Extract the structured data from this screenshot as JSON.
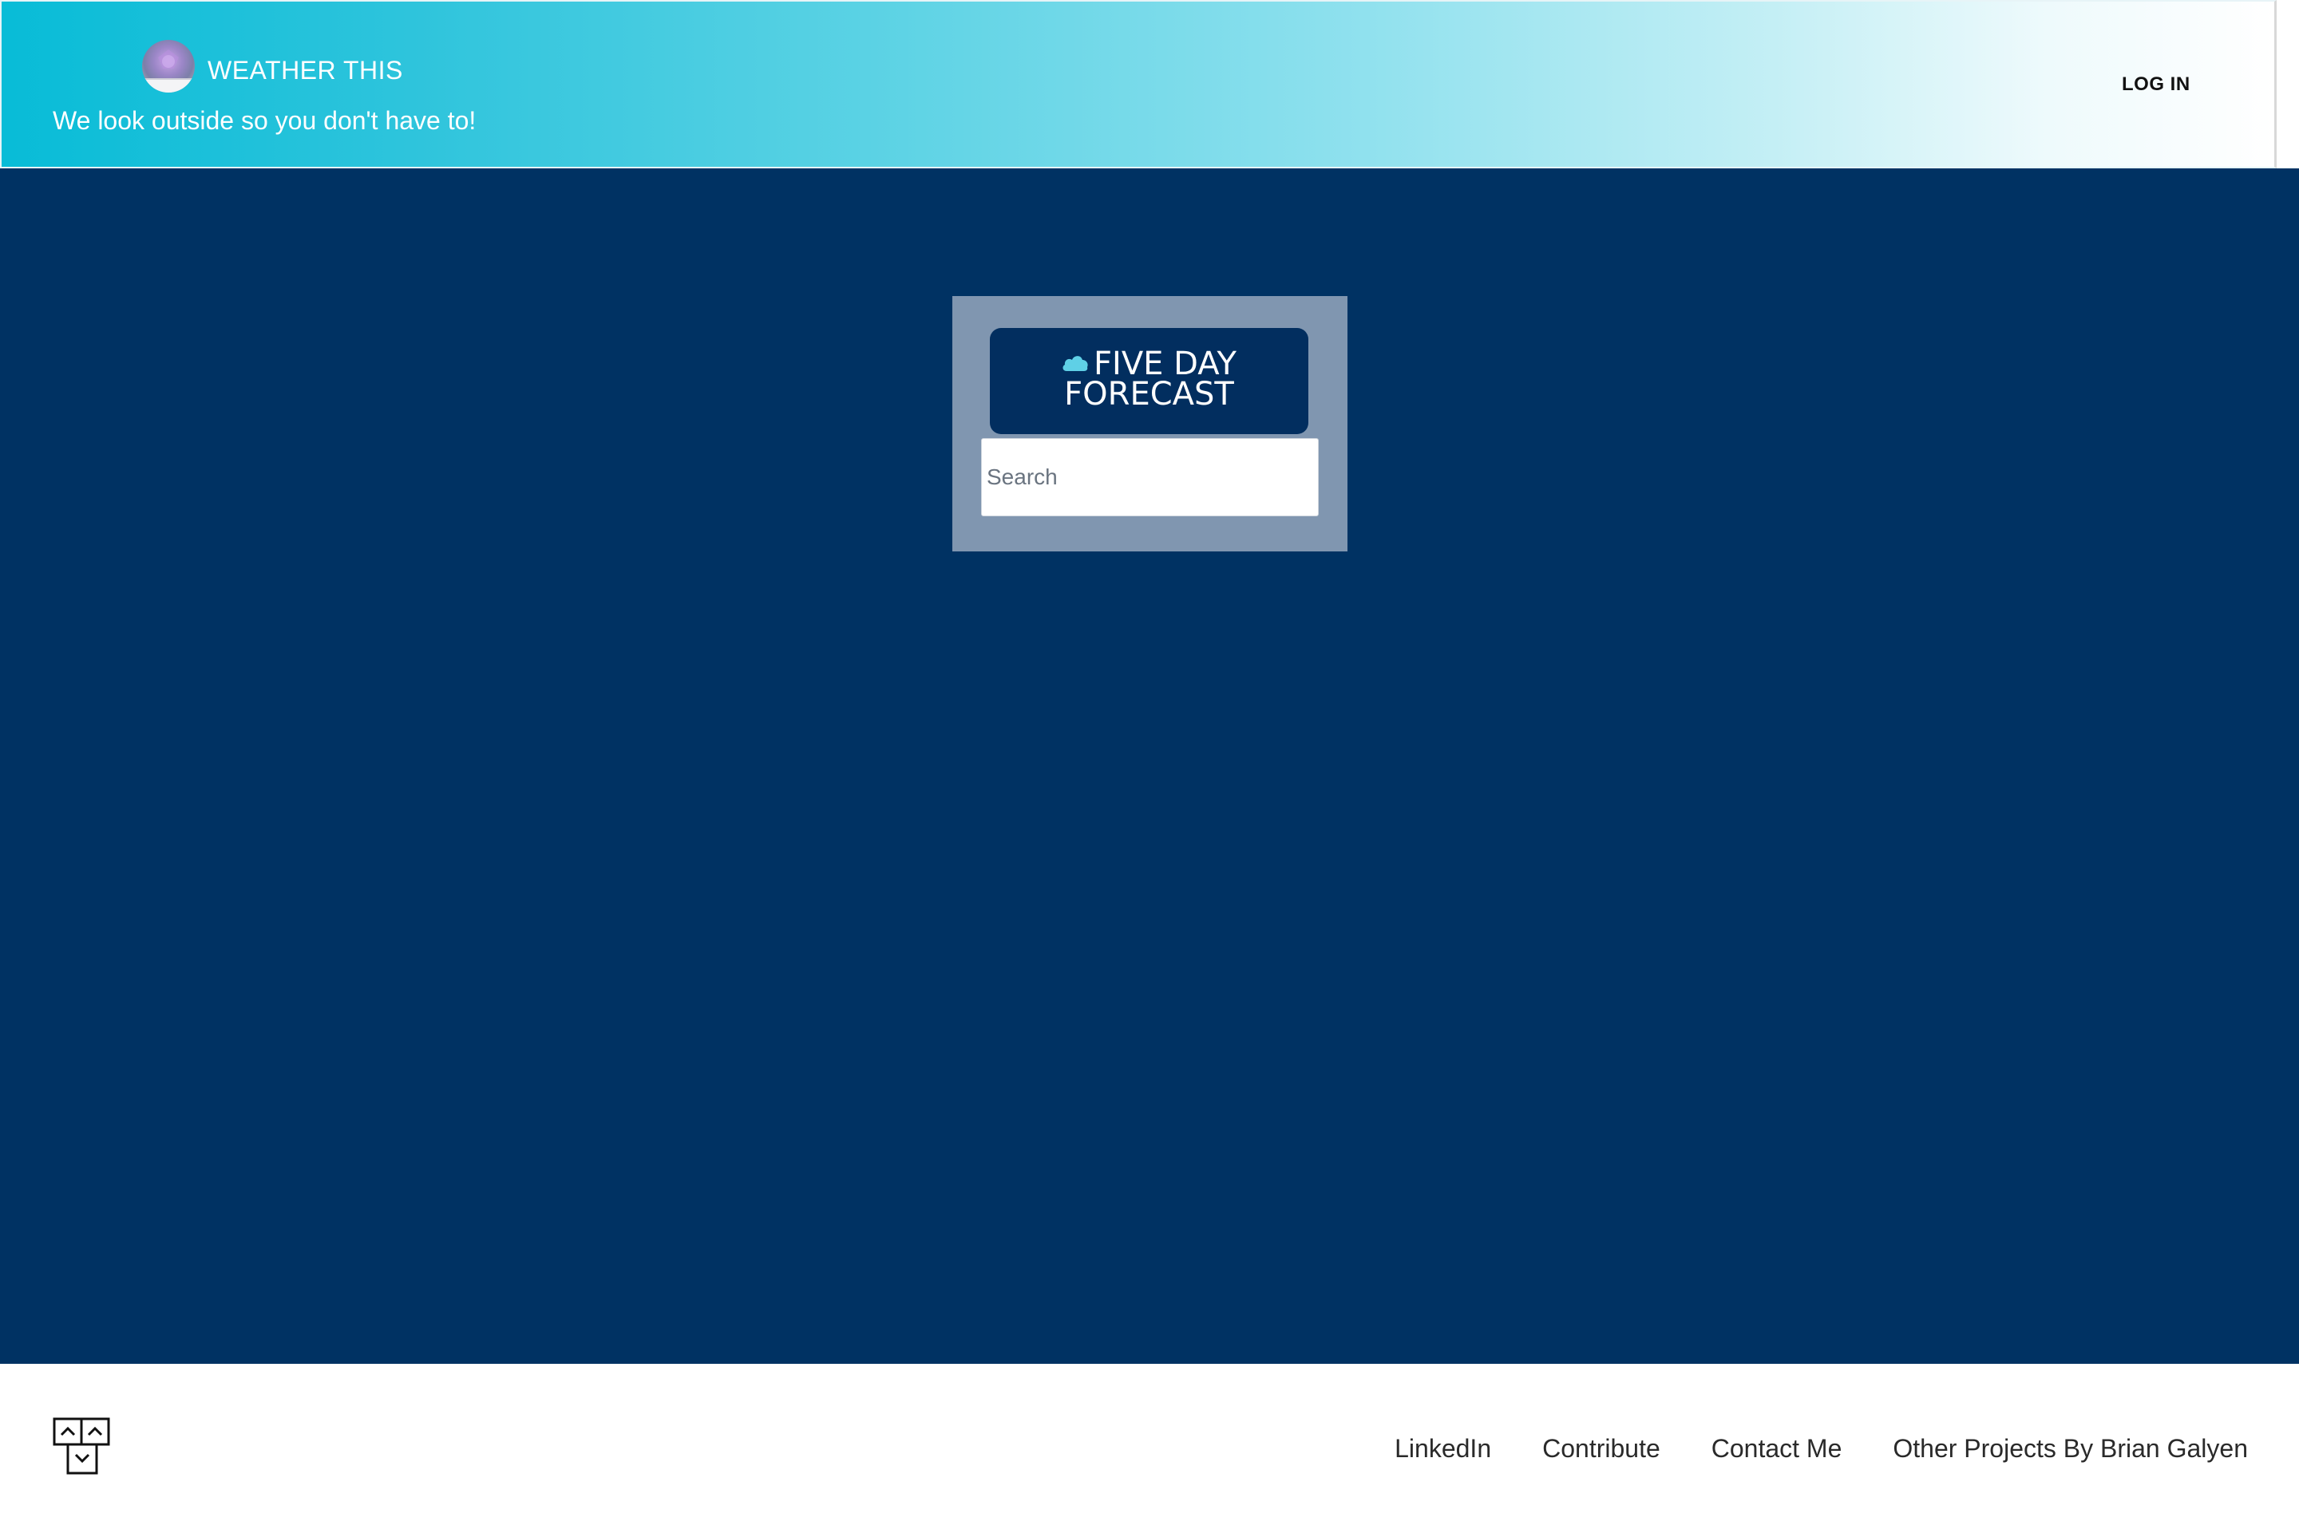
{
  "header": {
    "brand_name": "WEATHER THIS",
    "tagline": "We look outside so you don't have to!",
    "login_label": "LOG IN"
  },
  "forecast": {
    "title_line1": "FIVE DAY",
    "title_line2": "FORECAST",
    "search_placeholder": "Search",
    "search_value": ""
  },
  "footer": {
    "links": [
      {
        "label": "LinkedIn"
      },
      {
        "label": "Contribute"
      },
      {
        "label": "Contact Me"
      },
      {
        "label": "Other Projects By Brian Galyen"
      }
    ]
  },
  "icons": {
    "brand_logo": "weather-logo-icon",
    "title_icon": "cloud-icon",
    "footer_logo": "boxes-logo-icon"
  },
  "colors": {
    "header_gradient_start": "#08bcd7",
    "header_gradient_end": "#ffffff",
    "main_background": "#003263",
    "card_background": "#8096b0",
    "title_box_background": "#022e5f",
    "cloud_icon": "#5fd0e6"
  }
}
